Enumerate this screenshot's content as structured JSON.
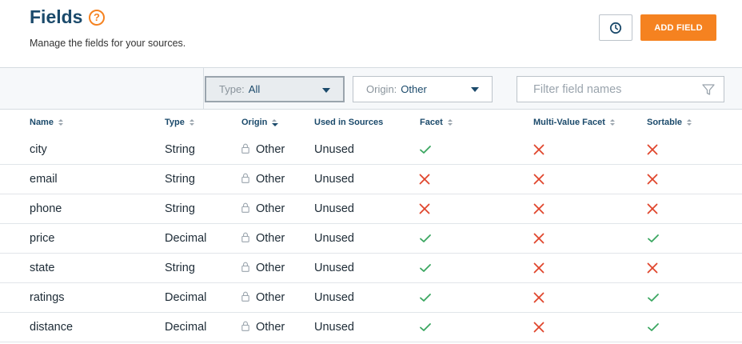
{
  "header": {
    "title": "Fields",
    "help_icon": "?",
    "subtitle": "Manage the fields for your sources.",
    "add_button": "ADD FIELD"
  },
  "filters": {
    "type_label": "Type:",
    "type_value": "All",
    "origin_label": "Origin:",
    "origin_value": "Other",
    "search_placeholder": "Filter field names"
  },
  "columns": [
    "Name",
    "Type",
    "Origin",
    "Used in Sources",
    "Facet",
    "Multi-Value Facet",
    "Sortable"
  ],
  "rows": [
    {
      "name": "city",
      "type": "String",
      "origin": "Other",
      "used": "Unused",
      "facet": true,
      "multi": false,
      "sortable": false
    },
    {
      "name": "email",
      "type": "String",
      "origin": "Other",
      "used": "Unused",
      "facet": false,
      "multi": false,
      "sortable": false
    },
    {
      "name": "phone",
      "type": "String",
      "origin": "Other",
      "used": "Unused",
      "facet": false,
      "multi": false,
      "sortable": false
    },
    {
      "name": "price",
      "type": "Decimal",
      "origin": "Other",
      "used": "Unused",
      "facet": true,
      "multi": false,
      "sortable": true
    },
    {
      "name": "state",
      "type": "String",
      "origin": "Other",
      "used": "Unused",
      "facet": true,
      "multi": false,
      "sortable": false
    },
    {
      "name": "ratings",
      "type": "Decimal",
      "origin": "Other",
      "used": "Unused",
      "facet": true,
      "multi": false,
      "sortable": true
    },
    {
      "name": "distance",
      "type": "Decimal",
      "origin": "Other",
      "used": "Unused",
      "facet": true,
      "multi": false,
      "sortable": true
    }
  ],
  "colors": {
    "accent": "#f58220",
    "title": "#1b4a6b",
    "check": "#3aa660",
    "cross": "#e0452c"
  }
}
